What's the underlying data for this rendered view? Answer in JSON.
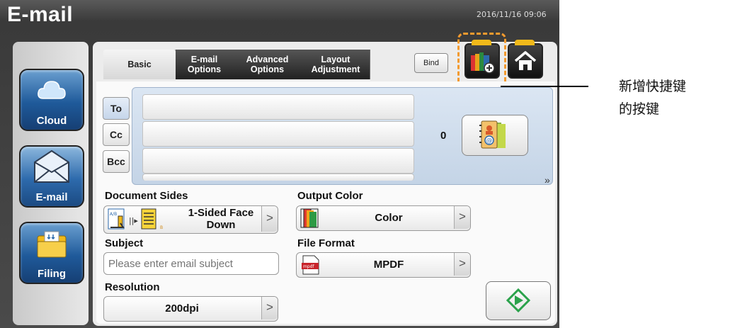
{
  "header": {
    "app_title": "E-mail",
    "datetime": "2016/11/16 09:06"
  },
  "sidebar": {
    "items": [
      {
        "label": "Cloud",
        "icon": "cloud-icon"
      },
      {
        "label": "E-mail",
        "icon": "envelope-icon",
        "active": true
      },
      {
        "label": "Filing",
        "icon": "folder-icon"
      }
    ]
  },
  "tabs": [
    {
      "label": "Basic",
      "active": true
    },
    {
      "label": "E-mail\nOptions"
    },
    {
      "label": "Advanced\nOptions"
    },
    {
      "label": "Layout\nAdjustment"
    }
  ],
  "toolbar": {
    "bind_label": "Bind",
    "add_shortcut_icon": "add-shortcut-icon",
    "home_icon": "home-icon"
  },
  "recipients": {
    "to_label": "To",
    "cc_label": "Cc",
    "bcc_label": "Bcc",
    "to_value": "",
    "cc_value": "",
    "bcc_value": "",
    "count": "0",
    "address_book_icon": "address-book-icon"
  },
  "more_indicator": "»",
  "settings": {
    "document_sides": {
      "label": "Document Sides",
      "value": "1-Sided Face\nDown"
    },
    "output_color": {
      "label": "Output Color",
      "value": "Color"
    },
    "subject": {
      "label": "Subject",
      "placeholder": "Please enter email subject",
      "value": ""
    },
    "file_format": {
      "label": "File Format",
      "value": "MPDF",
      "badge": "mpdf"
    },
    "resolution": {
      "label": "Resolution",
      "value": "200dpi"
    }
  },
  "start_icon": "start-icon",
  "annotation": {
    "text": "新增快捷键\n的按键"
  },
  "colors": {
    "accent_blue": "#2d6aac",
    "highlight_orange": "#f39a2e",
    "folder_yellow": "#f0b91a",
    "start_green": "#2aa24b"
  }
}
